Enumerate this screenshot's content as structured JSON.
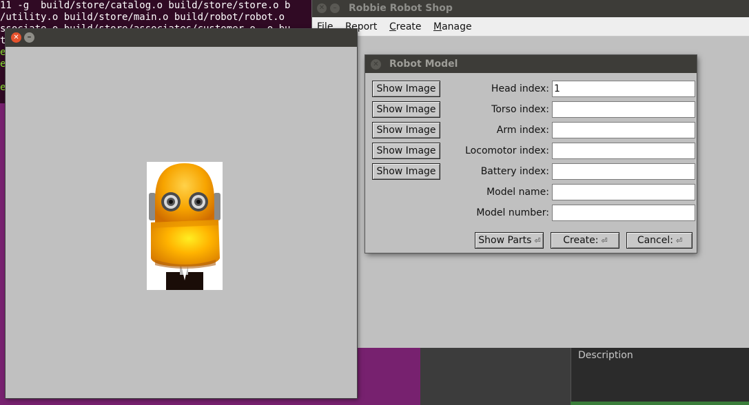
{
  "terminal": {
    "lines": [
      "11 -g  build/store/catalog.o build/store/store.o b",
      "/utility.o build/store/main.o build/robot/robot.o",
      "ssociate.o build/store/associates/customer.o -o bu",
      "t",
      "en",
      "en",
      "",
      "en"
    ]
  },
  "main_window": {
    "title": "Robbie Robot Shop",
    "menu": [
      {
        "label": "File",
        "mnemonic": "F",
        "rest": "ile"
      },
      {
        "label": "Report",
        "mnemonic": "R",
        "rest": "eport"
      },
      {
        "label": "Create",
        "mnemonic": "C",
        "rest": "reate"
      },
      {
        "label": "Manage",
        "mnemonic": "M",
        "rest": "anage"
      }
    ]
  },
  "image_window": {
    "close_icon": "close-icon",
    "minimize_icon": "minimize-icon",
    "image": "robot-head-image"
  },
  "dialog": {
    "title": "Robot Model",
    "show_image_label": "Show Image",
    "fields": [
      {
        "label": "Head index:",
        "value": "1"
      },
      {
        "label": "Torso index:",
        "value": ""
      },
      {
        "label": "Arm index:",
        "value": ""
      },
      {
        "label": "Locomotor index:",
        "value": ""
      },
      {
        "label": "Battery index:",
        "value": ""
      },
      {
        "label": "Model name:",
        "value": ""
      },
      {
        "label": "Model number:",
        "value": ""
      }
    ],
    "buttons": {
      "show_parts": "Show Parts",
      "create": "Create:",
      "cancel": "Cancel:"
    }
  },
  "description_panel": {
    "label": "Description"
  },
  "colors": {
    "desktop": "#77216f",
    "terminal_bg": "#300a24",
    "titlebar": "#3d3c38",
    "window_bg": "#c0c0c0",
    "close_accent": "#e6522c",
    "robot_orange": "#f5a000"
  }
}
